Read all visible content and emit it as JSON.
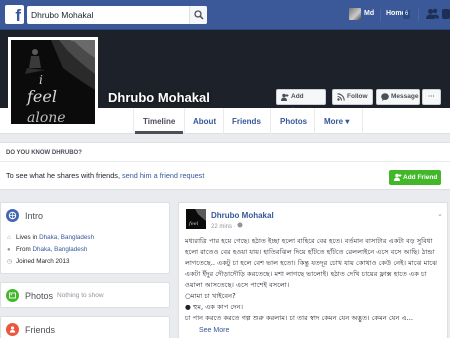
{
  "topbar": {
    "logo": "f",
    "search_value": "Dhrubo Mohakal",
    "user_name": "Md",
    "home_label": "Home",
    "home_badge": "6"
  },
  "profile": {
    "name": "Dhrubo Mohakal",
    "buttons": {
      "add_friend": "Add Friend",
      "follow": "Follow",
      "message": "Message",
      "more": "···"
    },
    "tabs": [
      "Timeline",
      "About",
      "Friends",
      "Photos",
      "More ▾"
    ]
  },
  "know_card": {
    "title": "DO YOU KNOW DHRUBO?",
    "text_prefix": "To see what he shares with friends,",
    "text_link": "send him a friend request",
    "button": "Add Friend"
  },
  "intro": {
    "title": "Intro",
    "lives_prefix": "Lives in",
    "lives_link": "Dhaka, Bangladesh",
    "from_prefix": "From",
    "from_link": "Dhaka, Bangladesh",
    "joined": "Joined March 2013"
  },
  "photos": {
    "title": "Photos",
    "subtitle": "Nothing to show"
  },
  "friends": {
    "title": "Friends"
  },
  "post": {
    "author": "Dhrubo Mohakal",
    "time": "22 mins · ",
    "body": "মধ্যরাত্রি পার হয়ে গেছে। হঠাত ইচ্ছা হলো বাহিরে বের হতে। বর্তমান বাসাটার একটা বড় সুবিধা হলো রাতেও বের হওয়া যায়। হাতিরঝিল দিয়ে হাঁটতে হাঁটতে রেললাইনে এসে বসে আছি। ঠান্ডা লাগতেছে.. একটু চা হলে বেশ ভাল হতো। কিন্তু যতদূর চোখ যায় কোথাও কেউ নেই। মাঝে মাঝে একটা ইঁদুর দৌড়াদৌড়ি করতেছে। মশা লাগছে ভালোই। হঠাত দেখি চায়ের ফ্লাক্স হাতে এক চা ওয়ালা আসতেছে। এসে পাশেই বসলো।\n○মামা চা খাইবেন?\n● হুম, এক কাপ দেন।\nচা পান করতে করতে গল্প শুরু করলাম। চা তার স্বাদ কেমন যেন অদ্ভুত। কেমন যেন এ...",
    "see_more": "See More"
  },
  "colors": {
    "fb_blue": "#3b5998",
    "link": "#365899",
    "green": "#42b72a"
  }
}
